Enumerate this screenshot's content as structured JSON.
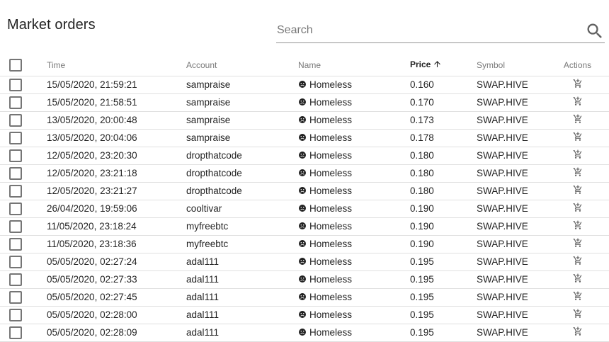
{
  "header": {
    "title": "Market orders"
  },
  "search": {
    "placeholder": "Search",
    "value": ""
  },
  "table": {
    "columns": {
      "time": "Time",
      "account": "Account",
      "name": "Name",
      "price": "Price",
      "symbol": "Symbol",
      "actions": "Actions"
    },
    "sorted_by": "price",
    "sort_direction": "ascending",
    "rows": [
      {
        "time": "15/05/2020, 21:59:21",
        "account": "sampraise",
        "name": "Homeless",
        "price": "0.160",
        "symbol": "SWAP.HIVE"
      },
      {
        "time": "15/05/2020, 21:58:51",
        "account": "sampraise",
        "name": "Homeless",
        "price": "0.170",
        "symbol": "SWAP.HIVE"
      },
      {
        "time": "13/05/2020, 20:00:48",
        "account": "sampraise",
        "name": "Homeless",
        "price": "0.173",
        "symbol": "SWAP.HIVE"
      },
      {
        "time": "13/05/2020, 20:04:06",
        "account": "sampraise",
        "name": "Homeless",
        "price": "0.178",
        "symbol": "SWAP.HIVE"
      },
      {
        "time": "12/05/2020, 23:20:30",
        "account": "dropthatcode",
        "name": "Homeless",
        "price": "0.180",
        "symbol": "SWAP.HIVE"
      },
      {
        "time": "12/05/2020, 23:21:18",
        "account": "dropthatcode",
        "name": "Homeless",
        "price": "0.180",
        "symbol": "SWAP.HIVE"
      },
      {
        "time": "12/05/2020, 23:21:27",
        "account": "dropthatcode",
        "name": "Homeless",
        "price": "0.180",
        "symbol": "SWAP.HIVE"
      },
      {
        "time": "26/04/2020, 19:59:06",
        "account": "cooltivar",
        "name": "Homeless",
        "price": "0.190",
        "symbol": "SWAP.HIVE"
      },
      {
        "time": "11/05/2020, 23:18:24",
        "account": "myfreebtc",
        "name": "Homeless",
        "price": "0.190",
        "symbol": "SWAP.HIVE"
      },
      {
        "time": "11/05/2020, 23:18:36",
        "account": "myfreebtc",
        "name": "Homeless",
        "price": "0.190",
        "symbol": "SWAP.HIVE"
      },
      {
        "time": "05/05/2020, 02:27:24",
        "account": "adal111",
        "name": "Homeless",
        "price": "0.195",
        "symbol": "SWAP.HIVE"
      },
      {
        "time": "05/05/2020, 02:27:33",
        "account": "adal111",
        "name": "Homeless",
        "price": "0.195",
        "symbol": "SWAP.HIVE"
      },
      {
        "time": "05/05/2020, 02:27:45",
        "account": "adal111",
        "name": "Homeless",
        "price": "0.195",
        "symbol": "SWAP.HIVE"
      },
      {
        "time": "05/05/2020, 02:28:00",
        "account": "adal111",
        "name": "Homeless",
        "price": "0.195",
        "symbol": "SWAP.HIVE"
      },
      {
        "time": "05/05/2020, 02:28:09",
        "account": "adal111",
        "name": "Homeless",
        "price": "0.195",
        "symbol": "SWAP.HIVE"
      }
    ]
  },
  "icons": {
    "search": "search-icon",
    "sort": "arrow-up-icon",
    "row_name": "sad-face-icon",
    "row_action": "cart-icon"
  },
  "colors": {
    "text_primary": "#212121",
    "text_secondary": "#757575",
    "divider": "#e0e0e0",
    "icon": "#616161"
  }
}
